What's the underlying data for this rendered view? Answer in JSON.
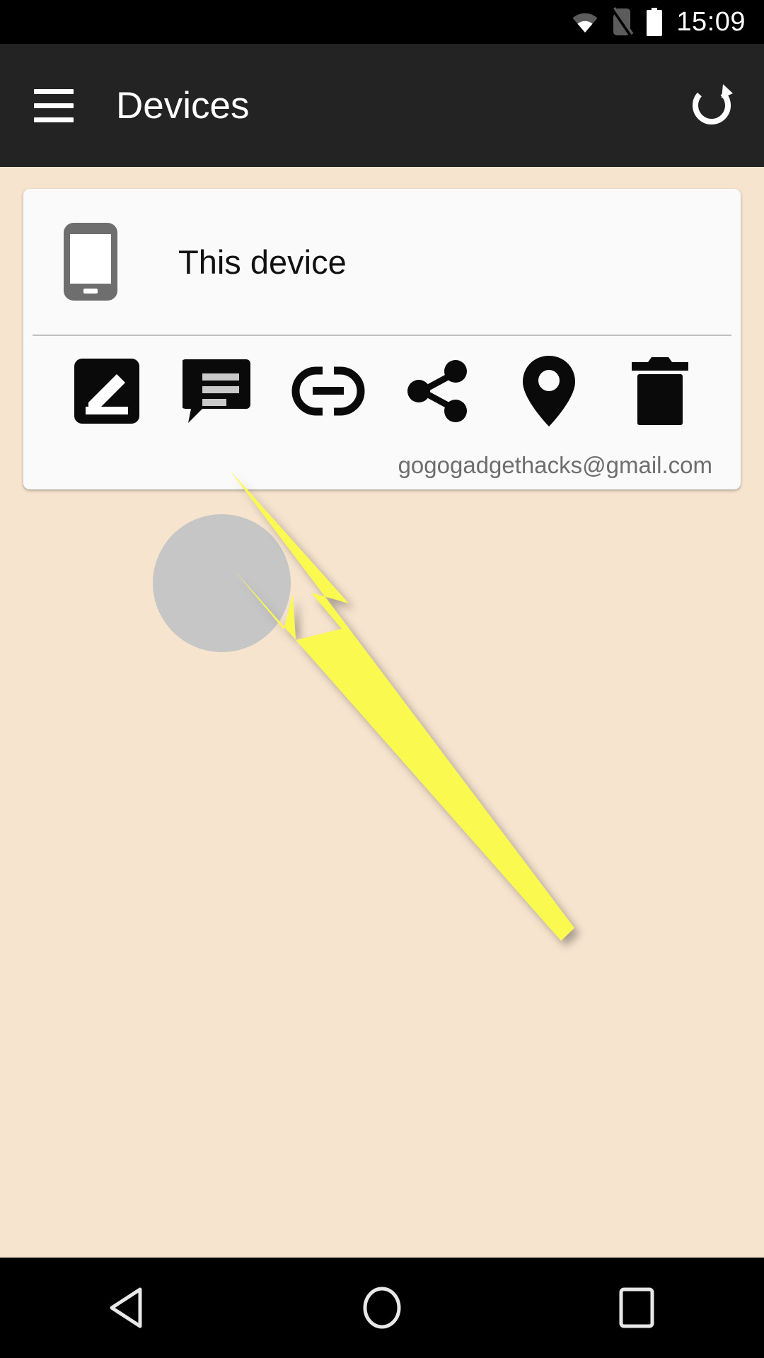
{
  "status_bar": {
    "time": "15:09",
    "icons": [
      {
        "name": "wifi-icon",
        "label": "Wi-Fi"
      },
      {
        "name": "sim-card-off-icon",
        "label": "No SIM"
      },
      {
        "name": "battery-full-icon",
        "label": "Battery full"
      }
    ],
    "background": "#000000",
    "foreground": "#FFFFFF"
  },
  "app_bar": {
    "title": "Devices",
    "menu_icon": "hamburger-menu-icon",
    "refresh_icon": "refresh-icon",
    "background": "#232323",
    "foreground": "#FFFFFF"
  },
  "card": {
    "device_name": "This device",
    "device_icon": "smartphone-icon",
    "account_email": "gogogadgethacks@gmail.com",
    "background": "#FAFAFA",
    "divider_color": "#BFBFBF",
    "actions": [
      {
        "name": "compose-button",
        "icon": "compose-edit-icon",
        "label": "Compose",
        "highlighted": false
      },
      {
        "name": "message-button",
        "icon": "message-chat-icon",
        "label": "Message",
        "highlighted": true
      },
      {
        "name": "link-button",
        "icon": "link-chain-icon",
        "label": "Link",
        "highlighted": false
      },
      {
        "name": "share-button",
        "icon": "share-icon",
        "label": "Share",
        "highlighted": false
      },
      {
        "name": "locate-button",
        "icon": "location-pin-icon",
        "label": "Locate",
        "highlighted": false
      },
      {
        "name": "delete-button",
        "icon": "trash-delete-icon",
        "label": "Delete",
        "highlighted": false
      }
    ]
  },
  "annotation": {
    "arrow_icon": "pointer-arrow-annotation",
    "arrow_color": "#FAF94F",
    "points_to": "message-button",
    "highlight_color": "#C6C6C6"
  },
  "nav_bar": {
    "background": "#000000",
    "buttons": [
      {
        "name": "nav-back-button",
        "icon": "back-triangle-icon",
        "label": "Back"
      },
      {
        "name": "nav-home-button",
        "icon": "home-circle-icon",
        "label": "Home"
      },
      {
        "name": "nav-recents-button",
        "icon": "recents-square-icon",
        "label": "Recents"
      }
    ]
  },
  "page": {
    "background": "#F6E4CE"
  }
}
